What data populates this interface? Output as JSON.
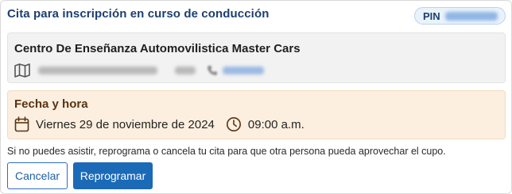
{
  "header": {
    "title": "Cita para inscripción en curso de conducción",
    "pin_label": "PIN"
  },
  "center": {
    "name": "Centro De Enseñanza Automovilistica Master Cars"
  },
  "schedule": {
    "title": "Fecha y hora",
    "date": "Viernes 29 de noviembre de 2024",
    "time": "09:00 a.m."
  },
  "notice": "Si no puedes asistir, reprograma o cancela tu cita para que otra persona pueda aprovechar el cupo.",
  "buttons": {
    "cancel": "Cancelar",
    "reschedule": "Reprogramar"
  },
  "colors": {
    "accent": "#1b6ab8",
    "title": "#1c3f73",
    "schedule_bg": "#fcefdf"
  }
}
